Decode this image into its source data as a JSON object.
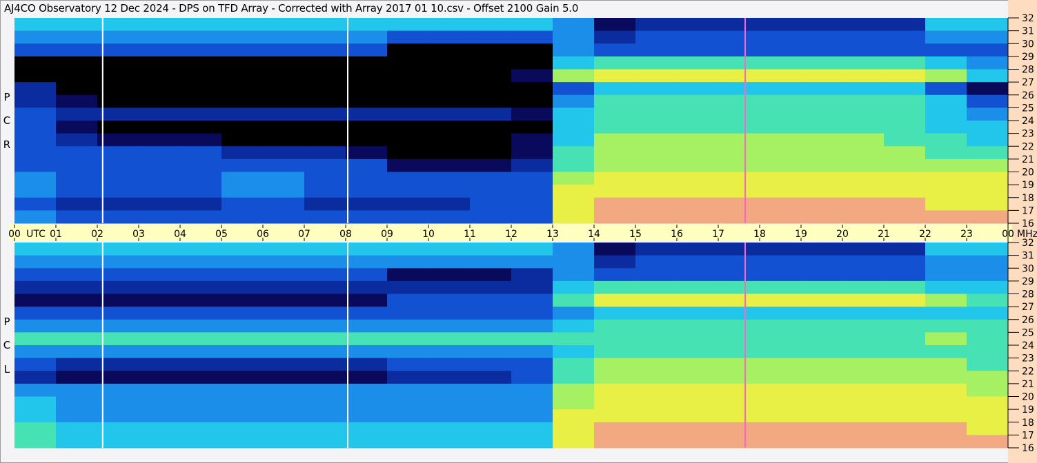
{
  "title": "AJ4CO Observatory  12 Dec 2024  -  DPS on TFD Array  -  Corrected with Array 2017 01 10.csv  -  Offset 2100  Gain 5.0",
  "chart_data": {
    "type": "heatmap",
    "x_axis": {
      "unit_label": "UTC",
      "tick_labels": [
        "00",
        "01",
        "02",
        "03",
        "04",
        "05",
        "06",
        "07",
        "08",
        "09",
        "10",
        "11",
        "12",
        "13",
        "14",
        "15",
        "16",
        "17",
        "18",
        "19",
        "20",
        "21",
        "22",
        "23",
        "00"
      ],
      "range_hours": [
        0,
        24
      ]
    },
    "y_axis": {
      "unit_label": "MHz",
      "tick_labels": [
        "16",
        "17",
        "18",
        "19",
        "20",
        "21",
        "22",
        "23",
        "24",
        "25",
        "26",
        "27",
        "28",
        "29",
        "30",
        "31",
        "32"
      ],
      "range_mhz": [
        16,
        32
      ]
    },
    "colormap": [
      "#000000",
      "#0a0a5c",
      "#0a2c9e",
      "#1252d2",
      "#1a8ee8",
      "#22c6ea",
      "#46e2b4",
      "#a6f064",
      "#e8f046",
      "#f2a880"
    ],
    "intensity_scale": [
      0,
      9
    ],
    "freq_bins_mhz_top_to_bottom": [
      31,
      30,
      29,
      28,
      27,
      26,
      25,
      24,
      23,
      22,
      21,
      20,
      19,
      18,
      17,
      16
    ],
    "vertical_features": [
      {
        "hour": 2.13,
        "color": "#ffffff"
      },
      {
        "hour": 8.05,
        "color": "#ffffff"
      },
      {
        "hour": 17.65,
        "color": "#ff66cc"
      }
    ],
    "panels": [
      {
        "label": [
          "R",
          "C",
          "P"
        ],
        "intensity": [
          [
            5,
            5,
            5,
            5,
            5,
            5,
            5,
            5,
            5,
            5,
            5,
            5,
            5,
            4,
            1,
            2,
            2,
            2,
            2,
            2,
            2,
            2,
            5,
            5
          ],
          [
            4,
            4,
            4,
            4,
            4,
            4,
            4,
            4,
            4,
            3,
            3,
            3,
            3,
            4,
            2,
            3,
            3,
            3,
            3,
            3,
            3,
            3,
            4,
            4
          ],
          [
            3,
            3,
            3,
            3,
            3,
            3,
            3,
            3,
            3,
            0,
            0,
            0,
            0,
            4,
            3,
            3,
            3,
            3,
            3,
            3,
            3,
            3,
            3,
            3
          ],
          [
            0,
            0,
            0,
            0,
            0,
            0,
            0,
            0,
            0,
            0,
            0,
            0,
            0,
            5,
            6,
            6,
            6,
            6,
            6,
            6,
            6,
            6,
            5,
            4
          ],
          [
            0,
            0,
            0,
            0,
            0,
            0,
            0,
            0,
            0,
            0,
            0,
            0,
            1,
            7,
            8,
            8,
            8,
            8,
            8,
            8,
            8,
            8,
            7,
            5
          ],
          [
            2,
            0,
            0,
            0,
            0,
            0,
            0,
            0,
            0,
            0,
            0,
            0,
            0,
            3,
            5,
            5,
            5,
            5,
            5,
            5,
            5,
            5,
            3,
            1
          ],
          [
            2,
            1,
            0,
            0,
            0,
            0,
            0,
            0,
            0,
            0,
            0,
            0,
            0,
            4,
            6,
            6,
            6,
            6,
            6,
            6,
            6,
            6,
            5,
            3
          ],
          [
            3,
            2,
            2,
            2,
            2,
            2,
            2,
            2,
            2,
            2,
            2,
            2,
            1,
            5,
            6,
            6,
            6,
            6,
            6,
            6,
            6,
            6,
            5,
            4
          ],
          [
            3,
            1,
            0,
            0,
            0,
            0,
            0,
            0,
            0,
            0,
            0,
            0,
            0,
            5,
            6,
            6,
            6,
            6,
            6,
            6,
            6,
            6,
            5,
            5
          ],
          [
            3,
            2,
            1,
            1,
            1,
            0,
            0,
            0,
            0,
            0,
            0,
            0,
            1,
            5,
            7,
            7,
            7,
            7,
            7,
            7,
            7,
            6,
            6,
            5
          ],
          [
            3,
            3,
            3,
            3,
            3,
            2,
            2,
            2,
            1,
            0,
            0,
            0,
            1,
            6,
            7,
            7,
            7,
            7,
            7,
            7,
            7,
            7,
            6,
            6
          ],
          [
            3,
            3,
            3,
            3,
            3,
            3,
            3,
            3,
            3,
            1,
            1,
            1,
            2,
            6,
            7,
            7,
            7,
            7,
            7,
            7,
            7,
            7,
            7,
            7
          ],
          [
            4,
            3,
            3,
            3,
            3,
            4,
            4,
            3,
            3,
            3,
            3,
            3,
            3,
            7,
            8,
            8,
            8,
            8,
            8,
            8,
            8,
            8,
            8,
            8
          ],
          [
            4,
            3,
            3,
            3,
            3,
            4,
            4,
            3,
            3,
            3,
            3,
            3,
            3,
            8,
            8,
            8,
            8,
            8,
            8,
            8,
            8,
            8,
            8,
            8
          ],
          [
            3,
            2,
            2,
            2,
            2,
            3,
            3,
            2,
            2,
            2,
            2,
            3,
            3,
            8,
            9,
            9,
            9,
            9,
            9,
            9,
            9,
            9,
            8,
            8
          ],
          [
            4,
            3,
            3,
            3,
            3,
            3,
            3,
            3,
            3,
            3,
            3,
            3,
            3,
            8,
            9,
            9,
            9,
            9,
            9,
            9,
            9,
            9,
            9,
            9
          ]
        ]
      },
      {
        "label": [
          "L",
          "C",
          "P"
        ],
        "intensity": [
          [
            5,
            5,
            5,
            5,
            5,
            5,
            5,
            5,
            5,
            5,
            5,
            5,
            5,
            4,
            1,
            2,
            2,
            2,
            2,
            2,
            2,
            2,
            5,
            5
          ],
          [
            4,
            4,
            4,
            4,
            4,
            4,
            4,
            4,
            4,
            4,
            4,
            4,
            4,
            4,
            2,
            3,
            3,
            3,
            3,
            3,
            3,
            3,
            4,
            4
          ],
          [
            3,
            3,
            3,
            3,
            3,
            3,
            3,
            3,
            3,
            1,
            1,
            1,
            2,
            4,
            3,
            3,
            3,
            3,
            3,
            3,
            3,
            3,
            4,
            4
          ],
          [
            2,
            2,
            2,
            2,
            2,
            2,
            2,
            2,
            2,
            2,
            2,
            2,
            2,
            5,
            6,
            6,
            6,
            6,
            6,
            6,
            6,
            6,
            5,
            5
          ],
          [
            1,
            1,
            1,
            1,
            1,
            1,
            1,
            1,
            1,
            3,
            3,
            3,
            3,
            6,
            8,
            8,
            8,
            8,
            8,
            8,
            8,
            8,
            7,
            6
          ],
          [
            3,
            3,
            3,
            3,
            3,
            3,
            3,
            3,
            3,
            3,
            3,
            3,
            3,
            4,
            5,
            5,
            5,
            5,
            5,
            5,
            5,
            5,
            5,
            5
          ],
          [
            4,
            4,
            4,
            4,
            4,
            4,
            4,
            4,
            4,
            4,
            4,
            4,
            4,
            5,
            6,
            6,
            6,
            6,
            6,
            6,
            6,
            6,
            6,
            6
          ],
          [
            6,
            6,
            6,
            6,
            6,
            6,
            6,
            6,
            6,
            6,
            6,
            6,
            6,
            6,
            6,
            6,
            6,
            6,
            6,
            6,
            6,
            6,
            7,
            6
          ],
          [
            4,
            4,
            4,
            4,
            4,
            4,
            4,
            4,
            4,
            4,
            4,
            4,
            4,
            5,
            6,
            6,
            6,
            6,
            6,
            6,
            6,
            6,
            6,
            6
          ],
          [
            3,
            2,
            2,
            2,
            2,
            2,
            2,
            2,
            2,
            3,
            3,
            3,
            3,
            6,
            7,
            7,
            7,
            7,
            7,
            7,
            7,
            7,
            7,
            6
          ],
          [
            2,
            1,
            1,
            1,
            1,
            1,
            1,
            1,
            1,
            2,
            2,
            2,
            3,
            6,
            7,
            7,
            7,
            7,
            7,
            7,
            7,
            7,
            7,
            7
          ],
          [
            4,
            4,
            4,
            4,
            4,
            4,
            4,
            4,
            4,
            4,
            4,
            4,
            4,
            7,
            8,
            8,
            8,
            8,
            8,
            8,
            8,
            8,
            8,
            7
          ],
          [
            5,
            4,
            4,
            4,
            4,
            4,
            4,
            4,
            4,
            4,
            4,
            4,
            4,
            7,
            8,
            8,
            8,
            8,
            8,
            8,
            8,
            8,
            8,
            8
          ],
          [
            5,
            4,
            4,
            4,
            4,
            4,
            4,
            4,
            4,
            4,
            4,
            4,
            4,
            8,
            8,
            8,
            8,
            8,
            8,
            8,
            8,
            8,
            8,
            8
          ],
          [
            6,
            5,
            5,
            5,
            5,
            5,
            5,
            5,
            5,
            5,
            5,
            5,
            5,
            8,
            9,
            9,
            9,
            9,
            9,
            9,
            9,
            9,
            9,
            8
          ],
          [
            6,
            5,
            5,
            5,
            5,
            5,
            5,
            5,
            5,
            5,
            5,
            5,
            5,
            8,
            9,
            9,
            9,
            9,
            9,
            9,
            9,
            9,
            9,
            9
          ]
        ]
      }
    ]
  }
}
